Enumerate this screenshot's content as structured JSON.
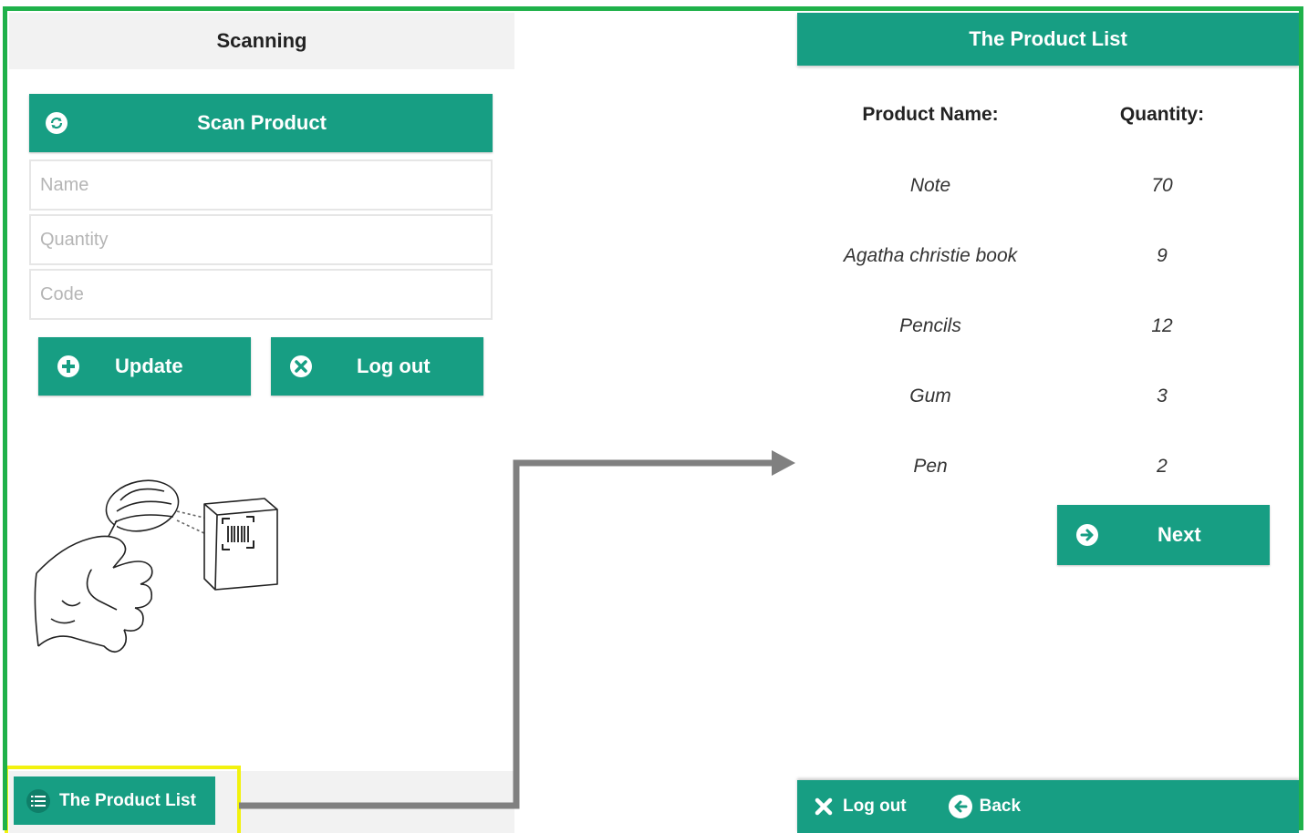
{
  "left_screen": {
    "title": "Scanning",
    "scan_button_label": "Scan Product",
    "fields": {
      "name_placeholder": "Name",
      "quantity_placeholder": "Quantity",
      "code_placeholder": "Code"
    },
    "update_label": "Update",
    "logout_label": "Log out",
    "product_list_button_label": "The Product List",
    "illustration": "hand-held-barcode-scanner-icon"
  },
  "right_screen": {
    "title": "The Product List",
    "columns": {
      "name": "Product Name:",
      "quantity": "Quantity:"
    },
    "rows": [
      {
        "name": "Note",
        "quantity": "70"
      },
      {
        "name": "Agatha christie book",
        "quantity": "9"
      },
      {
        "name": "Pencils",
        "quantity": "12"
      },
      {
        "name": "Gum",
        "quantity": "3"
      },
      {
        "name": "Pen",
        "quantity": "2"
      }
    ],
    "next_label": "Next",
    "footer": {
      "logout_label": "Log out",
      "back_label": "Back"
    }
  },
  "colors": {
    "accent": "#179e83",
    "frame_border": "#1fb14a",
    "highlight": "#f2f20e",
    "arrow": "#808080"
  }
}
